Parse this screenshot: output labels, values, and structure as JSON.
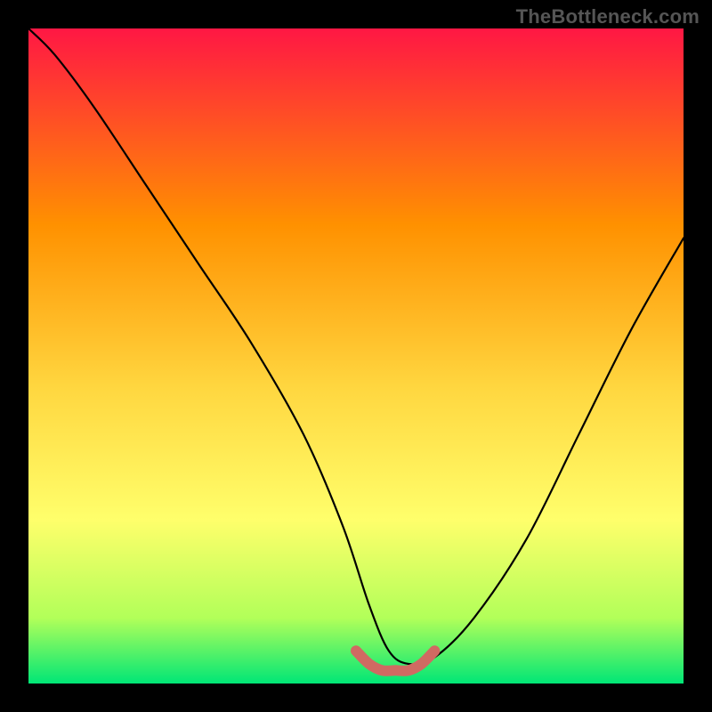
{
  "watermark": "TheBottleneck.com",
  "chart_data": {
    "type": "line",
    "title": "",
    "xlabel": "",
    "ylabel": "",
    "xlim": [
      0,
      100
    ],
    "ylim": [
      0,
      100
    ],
    "background_gradient": [
      "#ff1744",
      "#ff9100",
      "#ffd740",
      "#ffff6b",
      "#b2ff59",
      "#00e676"
    ],
    "series": [
      {
        "name": "bottleneck-curve",
        "color": "#000000",
        "x": [
          0,
          4,
          10,
          18,
          26,
          34,
          42,
          48,
          52,
          55,
          58,
          62,
          68,
          76,
          84,
          92,
          100
        ],
        "values": [
          100,
          96,
          88,
          76,
          64,
          52,
          38,
          24,
          12,
          5,
          3,
          4,
          10,
          22,
          38,
          54,
          68
        ]
      },
      {
        "name": "sweet-spot-marker",
        "color": "#d06a62",
        "x": [
          50,
          52,
          54,
          56,
          58,
          60,
          62
        ],
        "values": [
          5,
          3,
          2,
          2,
          2,
          3,
          5
        ]
      }
    ]
  }
}
